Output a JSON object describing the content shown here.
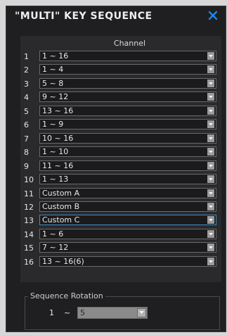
{
  "dialog": {
    "title": "\"MULTI\" KEY SEQUENCE",
    "close_icon": "close-icon",
    "accent_color": "#1e90ff"
  },
  "channel_table": {
    "header": "Channel",
    "rows": [
      {
        "num": "1",
        "value": "1 ~ 16"
      },
      {
        "num": "2",
        "value": "1 ~ 4"
      },
      {
        "num": "3",
        "value": "5 ~ 8"
      },
      {
        "num": "4",
        "value": "9 ~ 12"
      },
      {
        "num": "5",
        "value": "13 ~ 16"
      },
      {
        "num": "6",
        "value": "1 ~ 9"
      },
      {
        "num": "7",
        "value": "10 ~ 16"
      },
      {
        "num": "8",
        "value": "1 ~ 10"
      },
      {
        "num": "9",
        "value": "11 ~ 16"
      },
      {
        "num": "10",
        "value": "1 ~ 13"
      },
      {
        "num": "11",
        "value": "Custom A"
      },
      {
        "num": "12",
        "value": "Custom B"
      },
      {
        "num": "13",
        "value": "Custom C",
        "active": true
      },
      {
        "num": "14",
        "value": "1 ~ 6"
      },
      {
        "num": "15",
        "value": "7 ~ 12"
      },
      {
        "num": "16",
        "value": "13 ~ 16(6)"
      }
    ]
  },
  "sequence_rotation": {
    "label": "Sequence Rotation",
    "from": "1",
    "separator": "~",
    "to_value": "5"
  }
}
